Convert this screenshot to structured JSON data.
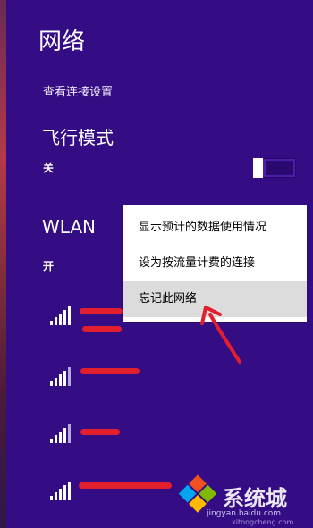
{
  "panel": {
    "title": "网络",
    "view_connection_settings": "查看连接设置",
    "airplane_mode": {
      "label": "飞行模式",
      "state": "关",
      "on": false
    },
    "wlan": {
      "label": "WLAN",
      "state": "开"
    }
  },
  "networks": [
    {
      "signal_bars": 5,
      "name_redacted": true
    },
    {
      "signal_bars": 4,
      "name_redacted": true
    },
    {
      "signal_bars": 4,
      "name_redacted": true
    },
    {
      "signal_bars": 5,
      "name_redacted": true
    }
  ],
  "context_menu": {
    "items": [
      "显示预计的数据使用情况",
      "设为按流量计费的连接",
      "忘记此网络"
    ],
    "highlighted_index": 2
  },
  "watermark": {
    "brand": "系统城",
    "url": "jingyan.baidu.com",
    "url2": "xitongcheng.com"
  },
  "colors": {
    "panel_bg": "#340c84",
    "menu_bg": "#ffffff",
    "highlight": "#dcdcdc",
    "annotation_red": "#e21f2e"
  }
}
